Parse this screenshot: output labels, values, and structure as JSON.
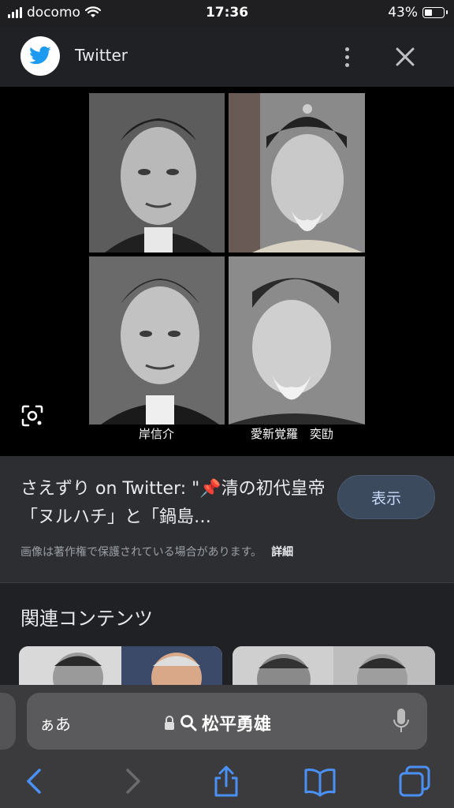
{
  "status": {
    "carrier": "docomo",
    "time": "17:36",
    "battery": "43%",
    "battery_level": 0.43
  },
  "header": {
    "title": "Twitter"
  },
  "image": {
    "caption_left": "岸信介",
    "caption_right": "愛新覚羅　奕劻"
  },
  "result": {
    "title": "さえずり on Twitter: \"📌清の初代皇帝「ヌルハチ」と「鍋島…",
    "view_button": "表示",
    "copyright": "画像は著作権で保護されている場合があります。",
    "details": "詳細"
  },
  "related": {
    "heading": "関連コンテンツ"
  },
  "address_bar": {
    "text_size": "ぁあ",
    "query": "松平勇雄"
  },
  "colors": {
    "background": "#202124",
    "panel": "#2d2e31",
    "button": "#3c4a5e",
    "safari_bar": "#3b3b3d",
    "accent": "#4a90f5"
  },
  "icons": [
    "twitter-bird-icon",
    "more-vertical-icon",
    "close-icon",
    "google-lens-icon",
    "lock-icon",
    "search-icon",
    "microphone-icon",
    "back-icon",
    "forward-icon",
    "share-icon",
    "bookmarks-icon",
    "tabs-icon"
  ]
}
